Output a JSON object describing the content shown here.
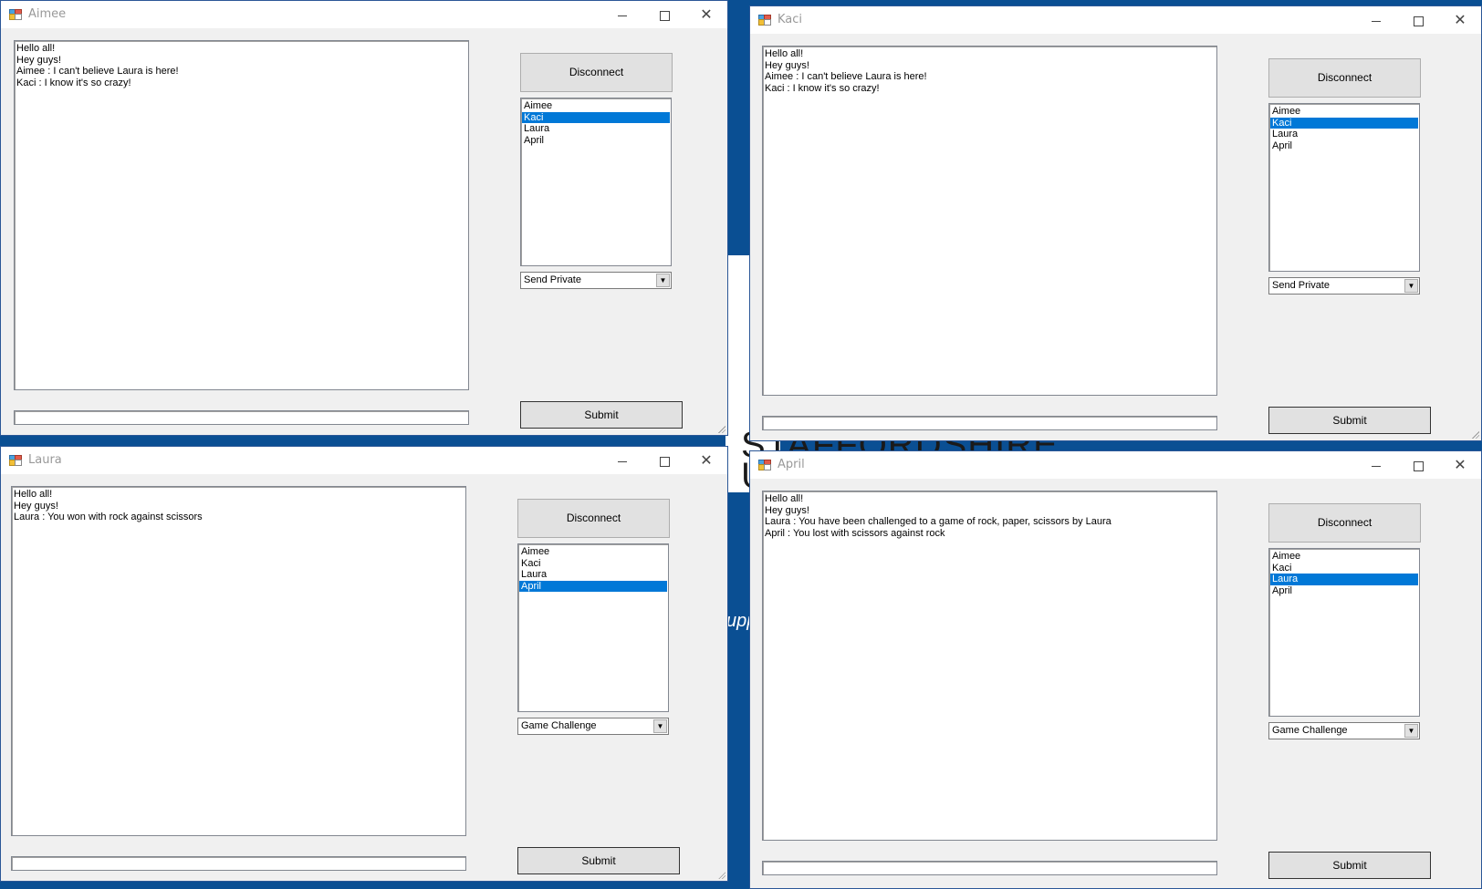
{
  "background": {
    "line1": "STAFFORDSHIRE",
    "line2": "U",
    "line3": "upp"
  },
  "common": {
    "disconnect_label": "Disconnect",
    "submit_label": "Submit"
  },
  "windows": [
    {
      "title": "Aimee",
      "messages": [
        "Hello all!",
        "Hey guys!",
        "Aimee : I can't believe Laura is here!",
        "Kaci : I know it's so crazy!"
      ],
      "users": [
        "Aimee",
        "Kaci",
        "Laura",
        "April"
      ],
      "selected_user": "Kaci",
      "mode": "Send Private",
      "input_value": ""
    },
    {
      "title": "Kaci",
      "messages": [
        "Hello all!",
        "Hey guys!",
        "Aimee : I can't believe Laura is here!",
        "Kaci : I know it's so crazy!"
      ],
      "users": [
        "Aimee",
        "Kaci",
        "Laura",
        "April"
      ],
      "selected_user": "Kaci",
      "mode": "Send Private",
      "input_value": ""
    },
    {
      "title": "Laura",
      "messages": [
        "Hello all!",
        "Hey guys!",
        "Laura : You won with rock against scissors"
      ],
      "users": [
        "Aimee",
        "Kaci",
        "Laura",
        "April"
      ],
      "selected_user": "April",
      "mode": "Game Challenge",
      "input_value": ""
    },
    {
      "title": "April",
      "messages": [
        "Hello all!",
        "Hey guys!",
        "Laura : You have been challenged to a game of rock, paper, scissors by Laura",
        "April : You lost with scissors against rock"
      ],
      "users": [
        "Aimee",
        "Kaci",
        "Laura",
        "April"
      ],
      "selected_user": "Laura",
      "mode": "Game Challenge",
      "input_value": ""
    }
  ],
  "colors": {
    "desktop": "#0a4f93",
    "selection": "#0078d7",
    "window_bg": "#f0f0f0"
  }
}
